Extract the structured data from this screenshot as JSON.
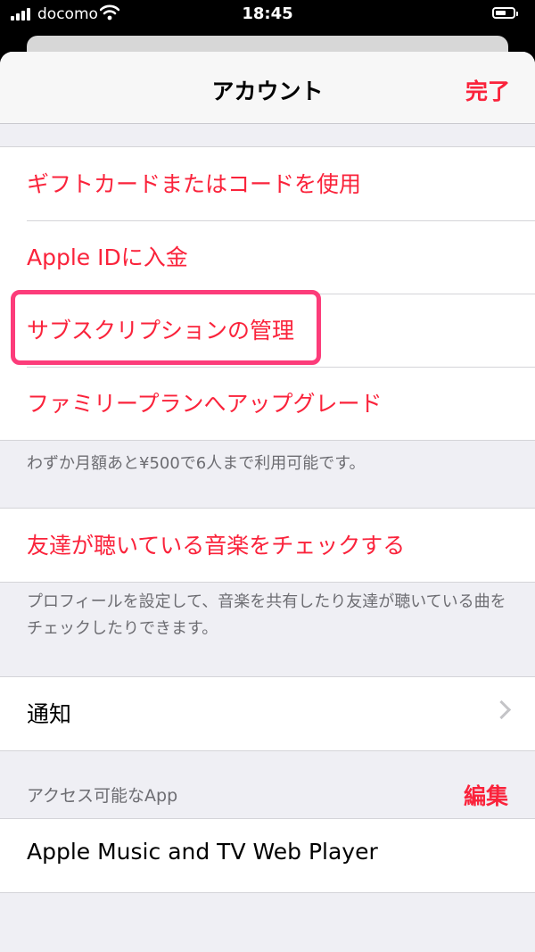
{
  "status_bar": {
    "carrier": "docomo",
    "time": "18:45"
  },
  "nav": {
    "title": "アカウント",
    "done_label": "完了"
  },
  "group1": {
    "items": [
      {
        "label": "ギフトカードまたはコードを使用"
      },
      {
        "label": "Apple IDに入金"
      },
      {
        "label": "サブスクリプションの管理"
      },
      {
        "label": "ファミリープランへアップグレード"
      }
    ],
    "footer": "わずか月額あと¥500で6人まで利用可能です。"
  },
  "group2": {
    "items": [
      {
        "label": "友達が聴いている音楽をチェックする"
      }
    ],
    "footer": "プロフィールを設定して、音楽を共有したり友達が聴いている曲をチェックしたりできます。"
  },
  "group3": {
    "items": [
      {
        "label": "通知"
      }
    ]
  },
  "apps_section": {
    "header": "アクセス可能なApp",
    "edit_label": "編集",
    "items": [
      {
        "label": "Apple Music and TV Web Player"
      }
    ]
  },
  "colors": {
    "accent": "#fa233b",
    "highlight": "#fc3c7a",
    "background": "#efeff4"
  }
}
